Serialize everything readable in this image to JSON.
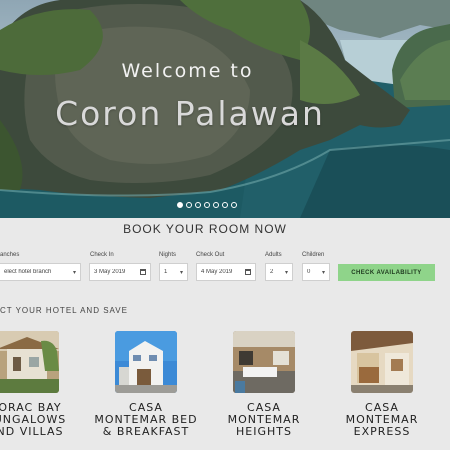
{
  "hero": {
    "welcome": "Welcome to",
    "destination": "Coron Palawan",
    "slides": [
      true,
      false,
      false,
      false,
      false,
      false,
      false
    ]
  },
  "booking": {
    "title": "BOOK YOUR ROOM NOW",
    "branches_label": "anches",
    "branches_value": "elect hotel branch",
    "checkin_label": "Check In",
    "checkin_value": "3 May 2019",
    "nights_label": "Nights",
    "nights_value": "1",
    "checkout_label": "Check Out",
    "checkout_value": "4 May 2019",
    "adults_label": "Adults",
    "adults_value": "2",
    "children_label": "Children",
    "children_value": "0",
    "check_button": "CHECK AVAILABILITY"
  },
  "hotels": {
    "title": "CT YOUR HOTEL AND SAVE",
    "items": [
      {
        "name": "ORAC BAY\nUNGALOWS\nND VILLAS"
      },
      {
        "name": "CASA\nMONTEMAR BED\n& BREAKFAST"
      },
      {
        "name": "CASA\nMONTEMAR\nHEIGHTS"
      },
      {
        "name": "CASA\nMONTEMAR\nEXPRESS"
      }
    ]
  },
  "colors": {
    "accent_green": "#8fd48a",
    "page_bg": "#e9e9e9"
  }
}
